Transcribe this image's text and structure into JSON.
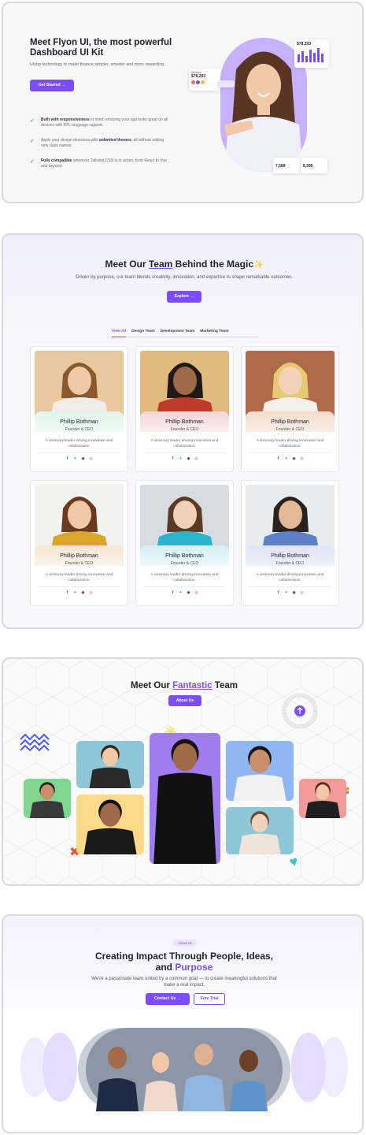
{
  "hero": {
    "title": "Meet Flyon UI, the most powerful Dashboard UI Kit",
    "subtitle": "Using technology to make finance simpler, smarter and more rewarding.",
    "cta_label": "Get Started →",
    "features": [
      {
        "bold": "Built with responsiveness",
        "text": " in mind, ensuring your app looks great on all devices with RTL language support."
      },
      {
        "pre": "Apply your design decisions with ",
        "bold": "unlimited themes",
        "text": ", all without adding new class names."
      },
      {
        "bold": "Fully compatible",
        "text": " wherever Tailwind CSS is in action, from React to Vue and beyond."
      }
    ],
    "widgets": {
      "balance_label": "Balance",
      "balance_value": "$78,203",
      "revenue_value": "$78,203",
      "stat1_value": "7,589",
      "stat2_value": "8,395"
    }
  },
  "team": {
    "heading_pre": "Meet Our ",
    "heading_hl": "Team",
    "heading_post": " Behind the Magic",
    "sparkle": "✨",
    "subtitle": "Driven by purpose, our team blends creativity, innovation, and expertise to shape remarkable outcomes.",
    "explore_label": "Explore →",
    "tabs": [
      "View All",
      "Design Team",
      "Development Team",
      "Marketing Team"
    ],
    "member_name": "Phillip Bothman",
    "member_role": "Founder & CEO",
    "member_desc": "A visionary leader driving innovation and collaboration."
  },
  "collage": {
    "heading_pre": "Meet Our ",
    "heading_hl": "Fantastic",
    "heading_post": " Team",
    "about_label": "About Us",
    "ring_text": "Team • Team Behind the Magic • Meet Our •"
  },
  "impact": {
    "badge": "About Us",
    "heading_line1": "Creating Impact Through People, Ideas,",
    "heading_and": "and ",
    "heading_hl": "Purpose",
    "subtitle": "We're a passionate team united by a common goal — to create meaningful solutions that make a real impact.",
    "contact_label": "Contact Us →",
    "trial_label": "Free Trial"
  },
  "colors": {
    "accent": "#7c4dff",
    "accent_light": "#c7b1ff",
    "success": "#34c38f"
  }
}
